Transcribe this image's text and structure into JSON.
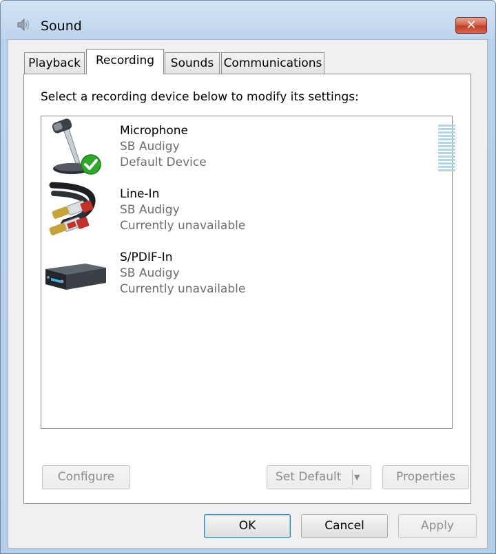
{
  "window": {
    "title": "Sound",
    "close_label": "✕"
  },
  "tabs": [
    {
      "label": "Playback",
      "active": false
    },
    {
      "label": "Recording",
      "active": true
    },
    {
      "label": "Sounds",
      "active": false
    },
    {
      "label": "Communications",
      "active": false
    }
  ],
  "panel": {
    "instruction": "Select a recording device below to modify its settings:"
  },
  "devices": [
    {
      "name": "Microphone",
      "sub": "SB Audigy",
      "status": "Default Device",
      "icon": "microphone-icon",
      "is_default": true
    },
    {
      "name": "Line-In",
      "sub": "SB Audigy",
      "status": "Currently unavailable",
      "icon": "line-in-cable-icon",
      "is_default": false
    },
    {
      "name": "S/PDIF-In",
      "sub": "SB Audigy",
      "status": "Currently unavailable",
      "icon": "spdif-device-icon",
      "is_default": false
    }
  ],
  "panel_buttons": {
    "configure": "Configure",
    "set_default": "Set Default",
    "properties": "Properties"
  },
  "dialog_buttons": {
    "ok": "OK",
    "cancel": "Cancel",
    "apply": "Apply"
  },
  "colors": {
    "close_button": "#c13c24",
    "default_check": "#2fa82b",
    "level_meter": "#b6d6e2",
    "secondary_text": "#6d6d6d"
  }
}
